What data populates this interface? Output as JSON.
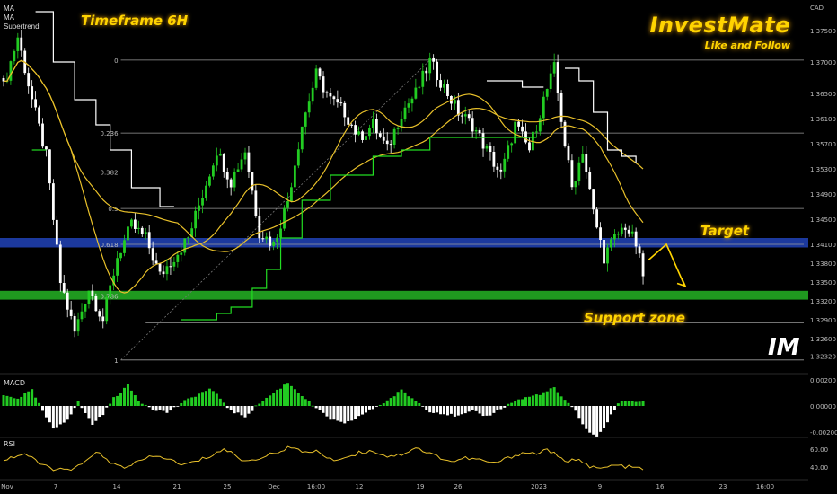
{
  "header": {
    "timeframe": "Timeframe 6H",
    "brand": "InvestMate",
    "tagline": "Like and Follow",
    "currency": "CAD",
    "indicators": [
      "MA",
      "MA",
      "Supertrend"
    ],
    "logo": "IM"
  },
  "annotations": {
    "target": "Target",
    "support": "Support zone"
  },
  "colors": {
    "bull": "#22cc22",
    "bear": "#ffffff",
    "ma_yellow": "#e8c02a",
    "supertrend_up": "#22dd22",
    "supertrend_down": "#ffffff",
    "target_zone": "#1f3fae",
    "support_zone": "#22aa22",
    "fib_line": "#9a9a9a",
    "annotation": "#ffd400",
    "rsi": "#e8c02a"
  },
  "chart_data": [
    {
      "type": "candlestick",
      "ylim": [
        1.321,
        1.379
      ],
      "y_ticks": [
        "1.37500",
        "1.37000",
        "1.36500",
        "1.36100",
        "1.35700",
        "1.35300",
        "1.34900",
        "1.34500",
        "1.34100",
        "1.33800",
        "1.33500",
        "1.33200",
        "1.32900",
        "1.32600",
        "1.32320"
      ],
      "x_ticks": [
        "Nov",
        "7",
        "14",
        "21",
        "25",
        "Dec",
        "16:00",
        "12",
        "19",
        "26",
        "2023",
        "9",
        "16",
        "23",
        "16:00"
      ],
      "fibonacci": [
        {
          "level": "0",
          "value": 1.3703
        },
        {
          "level": "0.236",
          "value": 1.3587
        },
        {
          "level": "0.382",
          "value": 1.3525
        },
        {
          "level": "0.5",
          "value": 1.3467
        },
        {
          "level": "0.618",
          "value": 1.341
        },
        {
          "level": "0.786",
          "value": 1.3328
        },
        {
          "level": "1",
          "value": 1.3226
        }
      ],
      "fib_extra_line": {
        "value": 1.3285
      },
      "target_zone": [
        1.3405,
        1.342
      ],
      "support_zone": [
        1.3322,
        1.3336
      ],
      "close_anchors": [
        [
          0,
          1.366
        ],
        [
          4,
          1.374
        ],
        [
          8,
          1.364
        ],
        [
          12,
          1.355
        ],
        [
          16,
          1.335
        ],
        [
          20,
          1.327
        ],
        [
          24,
          1.334
        ],
        [
          28,
          1.329
        ],
        [
          32,
          1.339
        ],
        [
          36,
          1.344
        ],
        [
          40,
          1.342
        ],
        [
          44,
          1.336
        ],
        [
          48,
          1.339
        ],
        [
          52,
          1.342
        ],
        [
          56,
          1.349
        ],
        [
          60,
          1.356
        ],
        [
          64,
          1.351
        ],
        [
          68,
          1.356
        ],
        [
          72,
          1.343
        ],
        [
          76,
          1.341
        ],
        [
          80,
          1.348
        ],
        [
          84,
          1.36
        ],
        [
          88,
          1.368
        ],
        [
          92,
          1.364
        ],
        [
          96,
          1.362
        ],
        [
          100,
          1.358
        ],
        [
          104,
          1.36
        ],
        [
          108,
          1.356
        ],
        [
          112,
          1.362
        ],
        [
          116,
          1.365
        ],
        [
          120,
          1.37
        ],
        [
          124,
          1.366
        ],
        [
          128,
          1.362
        ],
        [
          132,
          1.36
        ],
        [
          136,
          1.356
        ],
        [
          140,
          1.352
        ],
        [
          144,
          1.36
        ],
        [
          148,
          1.356
        ],
        [
          152,
          1.364
        ],
        [
          155,
          1.369
        ],
        [
          158,
          1.357
        ],
        [
          160,
          1.35
        ],
        [
          163,
          1.356
        ],
        [
          166,
          1.346
        ],
        [
          169,
          1.339
        ],
        [
          172,
          1.342
        ],
        [
          175,
          1.344
        ],
        [
          178,
          1.341
        ],
        [
          180,
          1.336
        ]
      ],
      "projection": [
        [
          0,
          1.3385
        ],
        [
          1,
          1.341
        ],
        [
          2,
          1.3345
        ]
      ]
    },
    {
      "type": "bar",
      "name": "MACD",
      "ylim": [
        -0.0022,
        0.0022
      ],
      "y_ticks": [
        "0.00200",
        "0.00000",
        "-0.00200"
      ],
      "anchors": [
        [
          0,
          0.0008
        ],
        [
          4,
          0.0006
        ],
        [
          8,
          0.0012
        ],
        [
          11,
          -0.0004
        ],
        [
          14,
          -0.0018
        ],
        [
          18,
          -0.001
        ],
        [
          21,
          0.0003
        ],
        [
          25,
          -0.0014
        ],
        [
          28,
          -0.0006
        ],
        [
          31,
          0.0006
        ],
        [
          35,
          0.0016
        ],
        [
          38,
          0.0004
        ],
        [
          42,
          -0.0002
        ],
        [
          46,
          -0.0005
        ],
        [
          50,
          0.0002
        ],
        [
          54,
          0.0008
        ],
        [
          58,
          0.0013
        ],
        [
          61,
          0.0006
        ],
        [
          64,
          -0.0004
        ],
        [
          68,
          -0.0008
        ],
        [
          72,
          0.0002
        ],
        [
          76,
          0.001
        ],
        [
          80,
          0.0018
        ],
        [
          84,
          0.0008
        ],
        [
          88,
          -0.0002
        ],
        [
          92,
          -0.001
        ],
        [
          96,
          -0.0014
        ],
        [
          100,
          -0.0008
        ],
        [
          104,
          -0.0002
        ],
        [
          108,
          0.0004
        ],
        [
          112,
          0.0012
        ],
        [
          116,
          0.0004
        ],
        [
          120,
          -0.0004
        ],
        [
          124,
          -0.0006
        ],
        [
          128,
          -0.0008
        ],
        [
          132,
          -0.0004
        ],
        [
          136,
          -0.0008
        ],
        [
          140,
          -0.0002
        ],
        [
          144,
          0.0004
        ],
        [
          148,
          0.0007
        ],
        [
          152,
          0.001
        ],
        [
          155,
          0.0014
        ],
        [
          158,
          0.0004
        ],
        [
          161,
          -0.0004
        ],
        [
          164,
          -0.0018
        ],
        [
          167,
          -0.0024
        ],
        [
          170,
          -0.0012
        ],
        [
          173,
          0.0002
        ],
        [
          176,
          0.0004
        ],
        [
          180,
          0.0003
        ]
      ]
    },
    {
      "type": "line",
      "name": "RSI",
      "ylim": [
        30,
        70
      ],
      "y_ticks": [
        "60.00",
        "40.00"
      ],
      "anchors": [
        [
          0,
          48
        ],
        [
          6,
          55
        ],
        [
          10,
          44
        ],
        [
          14,
          38
        ],
        [
          18,
          36
        ],
        [
          22,
          42
        ],
        [
          26,
          58
        ],
        [
          30,
          44
        ],
        [
          34,
          40
        ],
        [
          38,
          46
        ],
        [
          42,
          52
        ],
        [
          46,
          50
        ],
        [
          50,
          42
        ],
        [
          54,
          46
        ],
        [
          58,
          52
        ],
        [
          62,
          60
        ],
        [
          64,
          56
        ],
        [
          68,
          46
        ],
        [
          72,
          50
        ],
        [
          76,
          55
        ],
        [
          80,
          62
        ],
        [
          84,
          57
        ],
        [
          88,
          58
        ],
        [
          92,
          48
        ],
        [
          96,
          50
        ],
        [
          100,
          56
        ],
        [
          104,
          58
        ],
        [
          108,
          52
        ],
        [
          112,
          54
        ],
        [
          116,
          62
        ],
        [
          118,
          58
        ],
        [
          122,
          52
        ],
        [
          126,
          46
        ],
        [
          130,
          50
        ],
        [
          134,
          48
        ],
        [
          138,
          44
        ],
        [
          142,
          50
        ],
        [
          146,
          56
        ],
        [
          150,
          55
        ],
        [
          153,
          60
        ],
        [
          156,
          52
        ],
        [
          158,
          45
        ],
        [
          162,
          50
        ],
        [
          165,
          40
        ],
        [
          168,
          38
        ],
        [
          172,
          42
        ],
        [
          176,
          40
        ],
        [
          180,
          38
        ]
      ]
    }
  ]
}
